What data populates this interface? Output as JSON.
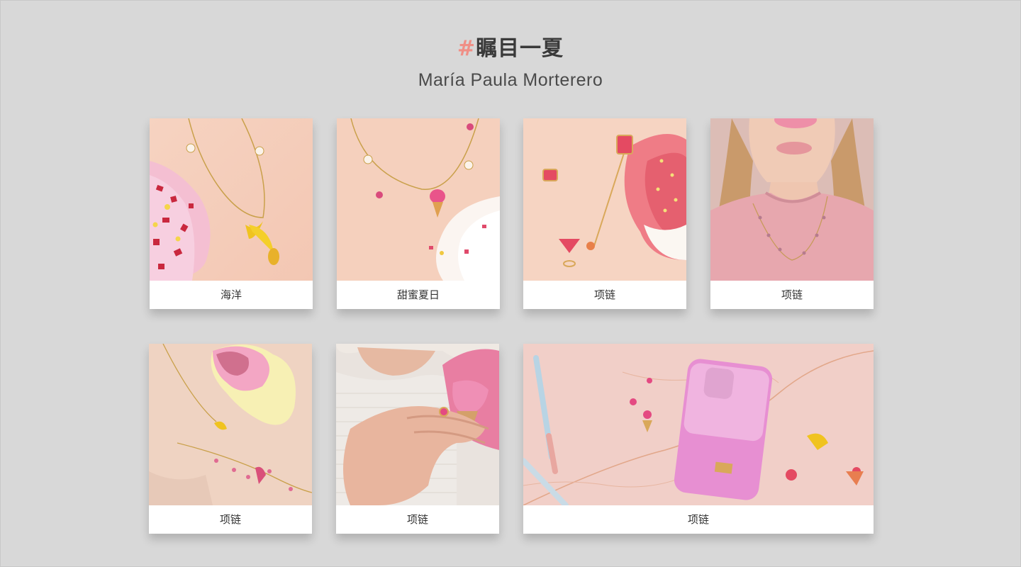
{
  "header": {
    "hash_symbol": "#",
    "title": "瞩目一夏",
    "subtitle": "María Paula Morterero"
  },
  "cards": [
    {
      "label": "海洋",
      "image": "banana-necklace-ice-cream-photo"
    },
    {
      "label": "甜蜜夏日",
      "image": "ice-cream-charm-necklace-photo"
    },
    {
      "label": "项链",
      "image": "cocktail-pin-earring-photo"
    },
    {
      "label": "项链",
      "image": "model-pink-sweater-necklace-photo"
    },
    {
      "label": "项链",
      "image": "long-chain-necklace-melted-ice-cream-photo"
    },
    {
      "label": "项链",
      "image": "hand-ring-phone-case-photo"
    },
    {
      "label": "项链",
      "image": "crystal-phone-case-pens-photo"
    }
  ],
  "colors": {
    "background": "#d8d8d8",
    "accent_hash": "#f08f86",
    "card": "#ffffff",
    "text": "#333333"
  }
}
